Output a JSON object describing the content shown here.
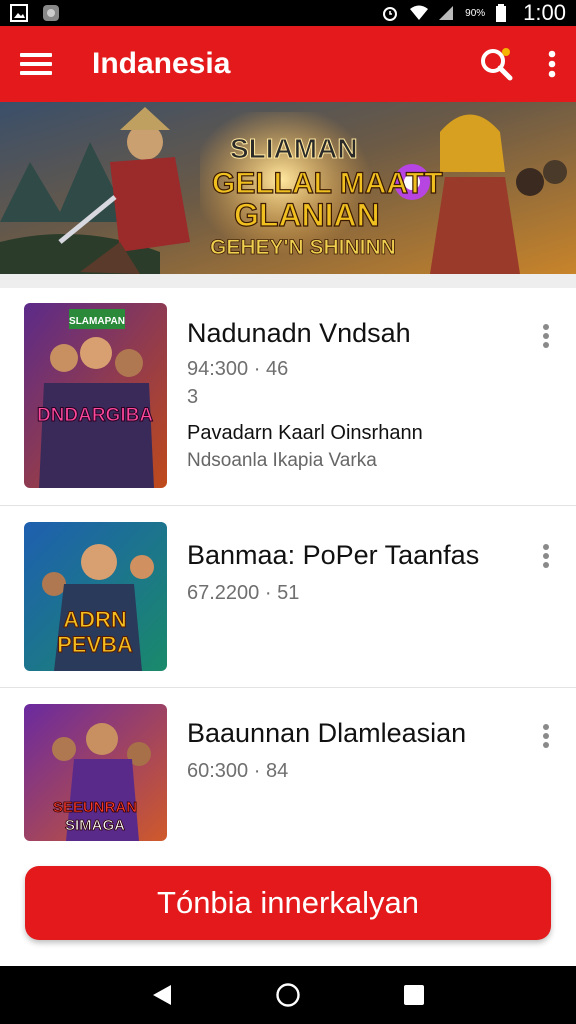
{
  "status_bar": {
    "battery_text": "90%",
    "time": "1:00",
    "icons": [
      "image-icon",
      "app-icon",
      "alarm-icon",
      "wifi-icon",
      "signal-icon",
      "battery-icon"
    ]
  },
  "app_bar": {
    "title": "Indanesia",
    "icons": [
      "menu-icon",
      "search-icon",
      "more-vert-icon"
    ],
    "accent_color": "#e3191b"
  },
  "banner": {
    "lines": [
      "SLIAMAN",
      "GELLAL MAATT",
      "GLANIAN",
      "GEHEY'N SHININN"
    ]
  },
  "items": [
    {
      "title": "Nadunadn Vndsah",
      "meta": "94:300 · 46",
      "meta2": "3",
      "sub1": "Pavadarn Kaarl Oinsrhann",
      "sub2": "Ndsoanla Ikapia Varka",
      "thumb_label_top": "SLAMAPAN",
      "thumb_label": "DNDARGIBA"
    },
    {
      "title": "Banmaa: PoPer Taanfas",
      "meta": "67.2200 · 51",
      "thumb_label_top": "ADRN",
      "thumb_label": "PEVBA"
    },
    {
      "title": "Baaunnan Dlamleasian",
      "meta": "60:300 · 84",
      "thumb_label_top": "SEEUNRAN",
      "thumb_label": "SIMAGA"
    }
  ],
  "cta": {
    "label": "Tónbia innerkalyan"
  },
  "nav": {
    "icons": [
      "back-icon",
      "home-icon",
      "recents-icon"
    ]
  }
}
